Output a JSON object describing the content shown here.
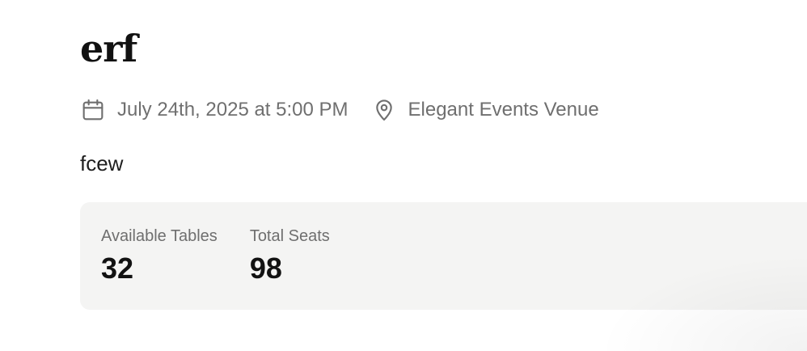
{
  "event": {
    "title": "erf",
    "datetime": "July 24th, 2025 at 5:00 PM",
    "venue": "Elegant Events Venue",
    "description": "fcew"
  },
  "icons": {
    "date": "calendar-icon",
    "venue": "map-pin-icon"
  },
  "stats": [
    {
      "label": "Available Tables",
      "value": "32"
    },
    {
      "label": "Total Seats",
      "value": "98"
    }
  ],
  "colors": {
    "muted_text": "#6f6f6f",
    "card_background": "#f4f4f3",
    "primary_text": "#111111"
  }
}
